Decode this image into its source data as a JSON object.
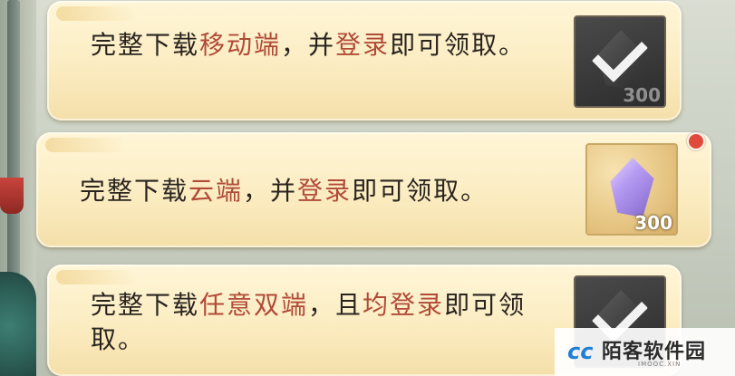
{
  "tasks": [
    {
      "segments": [
        {
          "text": "完整下载",
          "highlight": false
        },
        {
          "text": "移动端",
          "highlight": true
        },
        {
          "text": "，并",
          "highlight": false
        },
        {
          "text": "登录",
          "highlight": true
        },
        {
          "text": "即可领取。",
          "highlight": false
        }
      ],
      "reward": {
        "icon": "crystal-icon",
        "count": "300",
        "status": "claimed"
      }
    },
    {
      "segments": [
        {
          "text": "完整下载",
          "highlight": false
        },
        {
          "text": "云端",
          "highlight": true
        },
        {
          "text": "，并",
          "highlight": false
        },
        {
          "text": "登录",
          "highlight": true
        },
        {
          "text": "即可领取。",
          "highlight": false
        }
      ],
      "reward": {
        "icon": "crystal-icon",
        "count": "300",
        "status": "available"
      },
      "has_notification_dot": true
    },
    {
      "segments": [
        {
          "text": "完整下载",
          "highlight": false
        },
        {
          "text": "任意双端",
          "highlight": true
        },
        {
          "text": "，且",
          "highlight": false
        },
        {
          "text": "均登录",
          "highlight": true
        },
        {
          "text": "即可领取。",
          "highlight": false
        }
      ],
      "reward": {
        "icon": "crystal-icon",
        "count": "",
        "status": "claimed"
      }
    }
  ],
  "watermark": {
    "logo": "cc",
    "name": "陌客软件园",
    "sub": "IMOOC.XIN"
  },
  "colors": {
    "highlight": "#b14a37",
    "text": "#2a241f",
    "card": "#fbecc1",
    "notification": "#e04a3c"
  }
}
